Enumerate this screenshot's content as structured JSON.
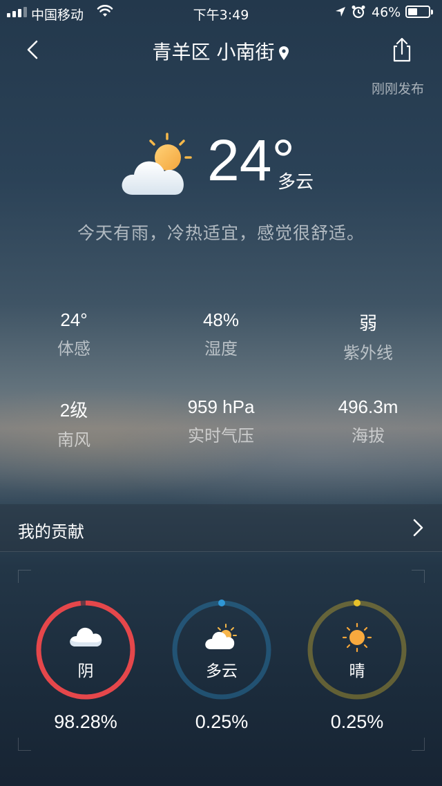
{
  "status_bar": {
    "carrier": "中国移动",
    "time": "下午3:49",
    "battery_text": "46%",
    "battery_level": 0.46
  },
  "header": {
    "location": "青羊区 小南街",
    "published": "刚刚发布"
  },
  "current": {
    "temperature": "24°",
    "condition": "多云",
    "summary": "今天有雨，冷热适宜，感觉很舒适。"
  },
  "stats": [
    {
      "value": "24°",
      "label": "体感"
    },
    {
      "value": "48%",
      "label": "湿度"
    },
    {
      "value": "弱",
      "label": "紫外线"
    },
    {
      "value": "2级",
      "label": "南风"
    },
    {
      "value": "959 hPa",
      "label": "实时气压"
    },
    {
      "value": "496.3m",
      "label": "海拔"
    }
  ],
  "contribution": {
    "title": "我的贡献",
    "votes": [
      {
        "label": "阴",
        "percent_text": "98.28%",
        "fraction": 0.9828,
        "color": "#e5474b",
        "icon": "cloud-icon"
      },
      {
        "label": "多云",
        "percent_text": "0.25%",
        "fraction": 0.0025,
        "color": "#2f97d6",
        "icon": "partly-cloudy-icon"
      },
      {
        "label": "晴",
        "percent_text": "0.25%",
        "fraction": 0.0025,
        "color": "#e8c22a",
        "icon": "sun-icon"
      }
    ]
  }
}
